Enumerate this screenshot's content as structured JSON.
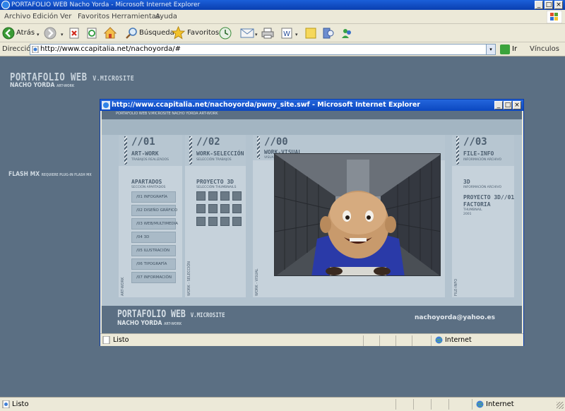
{
  "window": {
    "title": "PORTAFOLIO WEB Nacho Yorda - Microsoft Internet Explorer",
    "controls": {
      "minimize": "_",
      "maximize": "□",
      "close": "×"
    }
  },
  "menu": [
    "Archivo",
    "Edición",
    "Ver",
    "Favoritos",
    "Herramientas",
    "Ayuda"
  ],
  "toolbar": {
    "back": "Atrás",
    "search": "Búsqueda",
    "favorites": "Favoritos"
  },
  "address": {
    "label": "Dirección",
    "url": "http://www.ccapitalia.net/nachoyorda/#",
    "go": "Ir",
    "links": "Vínculos"
  },
  "page": {
    "title": "PORTAFOLIO WEB",
    "title_suffix": "V.MICROSITE",
    "author": "NACHO YORDA",
    "author_tag": "ART-WORK",
    "flash": "FLASH MX",
    "flash_note": "REQUIERE PLUG-IN FLASH MX"
  },
  "popup": {
    "title": "http://www.ccapitalia.net/nachoyorda/pwny_site.swf - Microsoft Internet Explorer",
    "header": "PORTAFOLIO WEB  V.MICROSITE  NACHO YORDA  ART-WORK",
    "status": "Listo",
    "zone": "Internet",
    "columns": [
      {
        "num": "//01",
        "name": "ART-WORK",
        "sub": "TRABAJOS REALIZADOS",
        "vlabel": "ART-WORK"
      },
      {
        "num": "//02",
        "name": "WORK-SELECCIÓN",
        "sub": "SELECCIÓN TRABAJOS",
        "vlabel": "WORK - SELECCIÓN"
      },
      {
        "num": "//00",
        "name": "WORK-VISUAL",
        "sub": "VISUALIZACIÓN TRABAJOS",
        "vlabel": "WORK - VISUAL"
      },
      {
        "num": "//03",
        "name": "FILE-INFO",
        "sub": "INFORMACIÓN ARCHIVO",
        "vlabel": "FILE-INFO"
      }
    ],
    "apartados": {
      "heading": "APARTADOS",
      "sub": "SECCIÓN APARTADOS",
      "items": [
        "/01 INFOGRAFÍA",
        "/02 DISEÑO GRÁFICO",
        "/03 WEB/MULTIMEDIA",
        "/04 3D",
        "/05 ILUSTRACIÓN",
        "/06 TIPOGRAFÍA",
        "/07 INFORMACIÓN"
      ]
    },
    "proyecto": {
      "heading": "PROYECTO 3D",
      "sub": "SELECCIÓN THUMBNAILS"
    },
    "info": {
      "line1": "3D",
      "line1_sub": "INFORMACIÓN ARCHIVO",
      "line2": "PROYECTO 3D//01",
      "line3": "FACTORIA",
      "line3_sub": "THUMBNAIL",
      "line3_year": "2001"
    },
    "footer": {
      "title": "PORTAFOLIO WEB",
      "title_suffix": "V.MICROSITE",
      "author": "NACHO YORDA",
      "author_tag": "ART-WORK",
      "email": "nachoyorda@yahoo.es"
    }
  },
  "status": {
    "text": "Listo",
    "zone": "Internet"
  }
}
